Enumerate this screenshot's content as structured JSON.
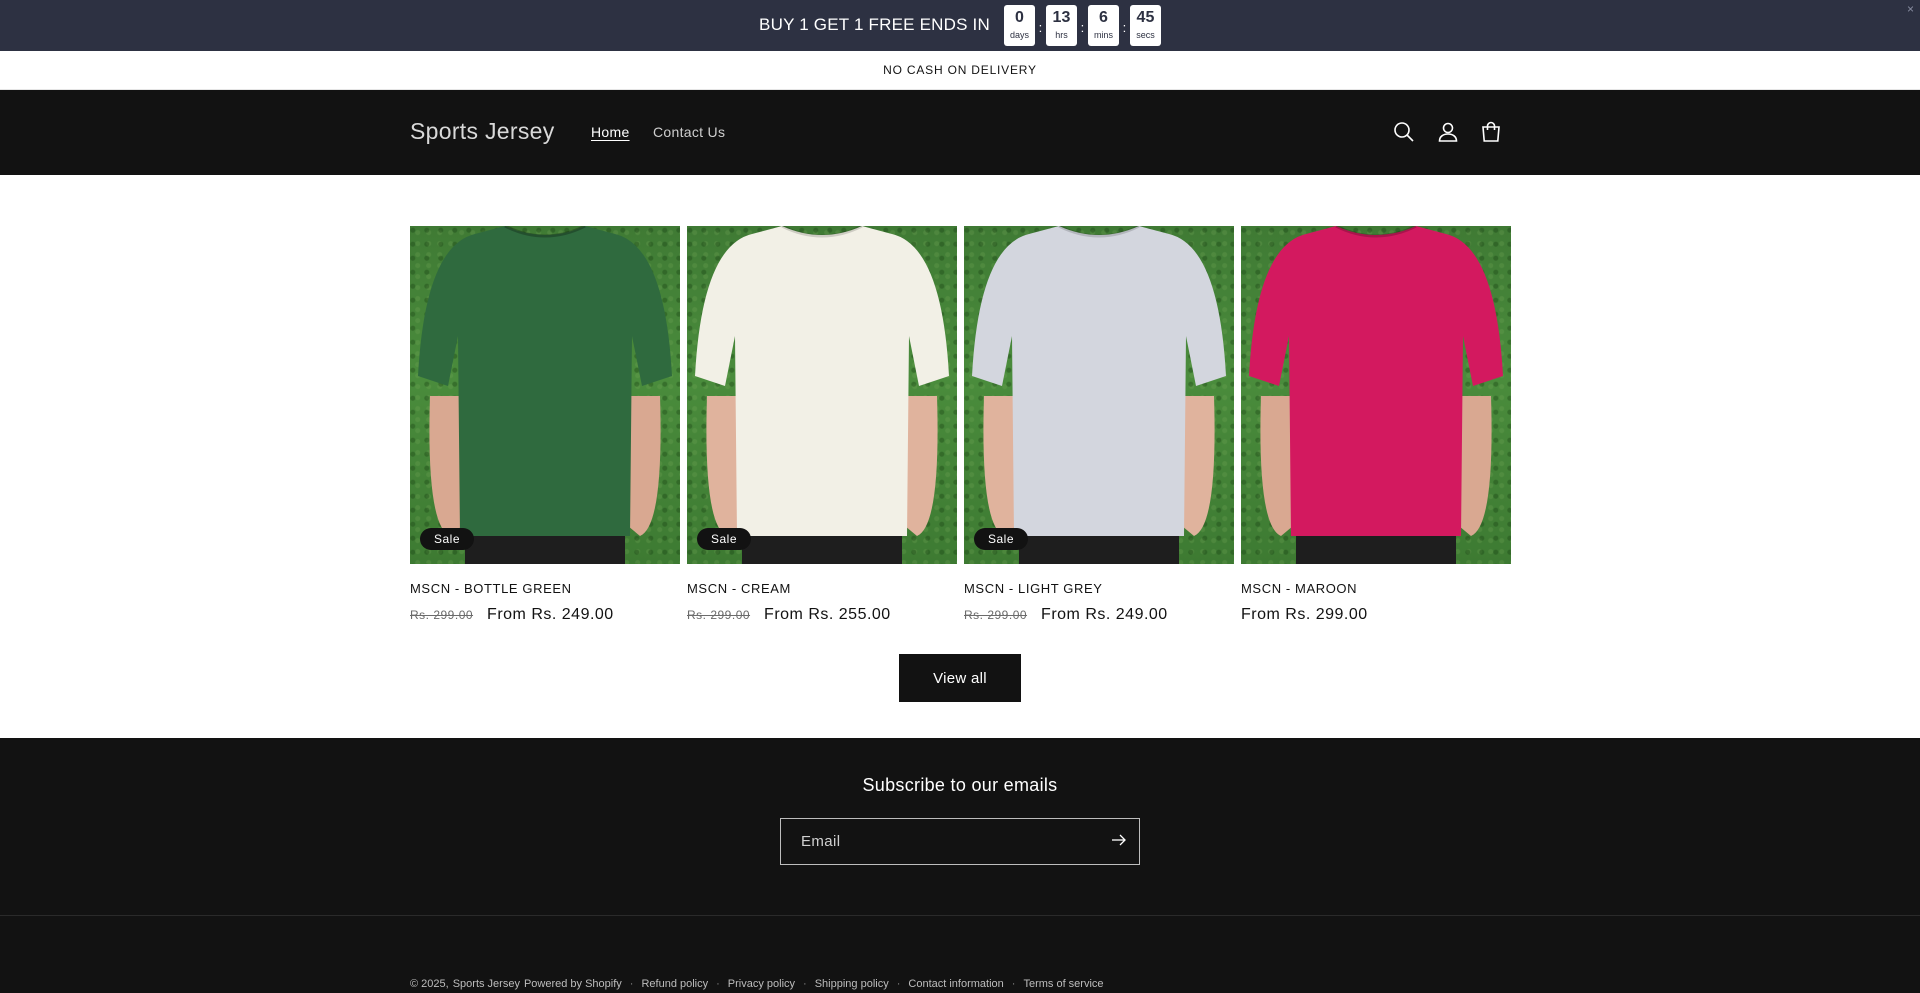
{
  "countdown": {
    "text": "BUY 1 GET 1 FREE ENDS IN",
    "days": {
      "value": "0",
      "label": "days"
    },
    "hours": {
      "value": "13",
      "label": "hrs"
    },
    "minutes": {
      "value": "6",
      "label": "mins"
    },
    "seconds": {
      "value": "45",
      "label": "secs"
    },
    "separator": ":",
    "close": "×"
  },
  "announcement": "NO CASH ON DELIVERY",
  "header": {
    "logo": "Sports Jersey",
    "nav": [
      {
        "label": "Home"
      },
      {
        "label": "Contact Us"
      }
    ],
    "icons": [
      "search-icon",
      "account-icon",
      "cart-icon"
    ]
  },
  "products": [
    {
      "title": "MSCN - BOTTLE GREEN",
      "old_price": "Rs. 299.00",
      "price": "From Rs. 249.00",
      "badge": "Sale",
      "color": "#2f6a3e"
    },
    {
      "title": "MSCN - CREAM",
      "old_price": "Rs. 299.00",
      "price": "From Rs. 255.00",
      "badge": "Sale",
      "color": "#f2f0e6"
    },
    {
      "title": "MSCN - LIGHT GREY",
      "old_price": "Rs. 299.00",
      "price": "From Rs. 249.00",
      "badge": "Sale",
      "color": "#d3d6de"
    },
    {
      "title": "MSCN - MAROON",
      "old_price": "",
      "price": "From Rs. 299.00",
      "badge": "",
      "color": "#d3195f"
    }
  ],
  "view_all": "View all",
  "footer": {
    "subscribe_title": "Subscribe to our emails",
    "email_placeholder": "Email",
    "copyright": "© 2025,",
    "store_link": "Sports Jersey",
    "powered": "Powered by Shopify",
    "links": [
      "Refund policy",
      "Privacy policy",
      "Shipping policy",
      "Contact information",
      "Terms of service"
    ]
  }
}
